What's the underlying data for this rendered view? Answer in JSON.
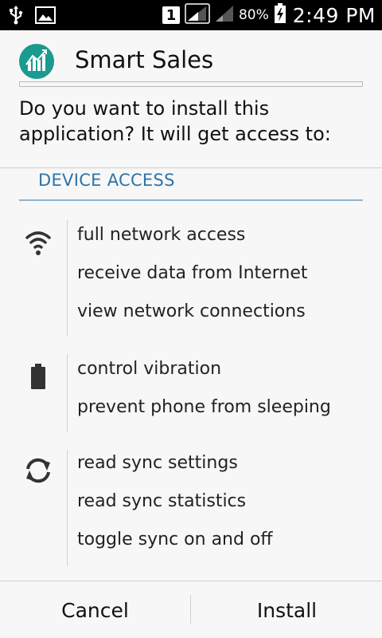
{
  "status_bar": {
    "left_icons": [
      "usb-icon",
      "image-icon"
    ],
    "sim_label": "1",
    "battery_percent": "80%",
    "time": "2:49 PM"
  },
  "app": {
    "name": "Smart Sales",
    "icon": "chart-icon",
    "icon_color": "#1b9a8f"
  },
  "prompt": "Do you want to install this application? It will get access to:",
  "section": {
    "title": "DEVICE ACCESS",
    "color": "#2f74a8"
  },
  "permission_groups": [
    {
      "icon": "wifi-icon",
      "items": [
        "full network access",
        "receive data from Internet",
        "view network connections"
      ]
    },
    {
      "icon": "battery-icon",
      "items": [
        "control vibration",
        "prevent phone from sleeping"
      ]
    },
    {
      "icon": "sync-icon",
      "items": [
        "read sync settings",
        "read sync statistics",
        "toggle sync on and off"
      ]
    }
  ],
  "buttons": {
    "cancel": "Cancel",
    "install": "Install"
  }
}
